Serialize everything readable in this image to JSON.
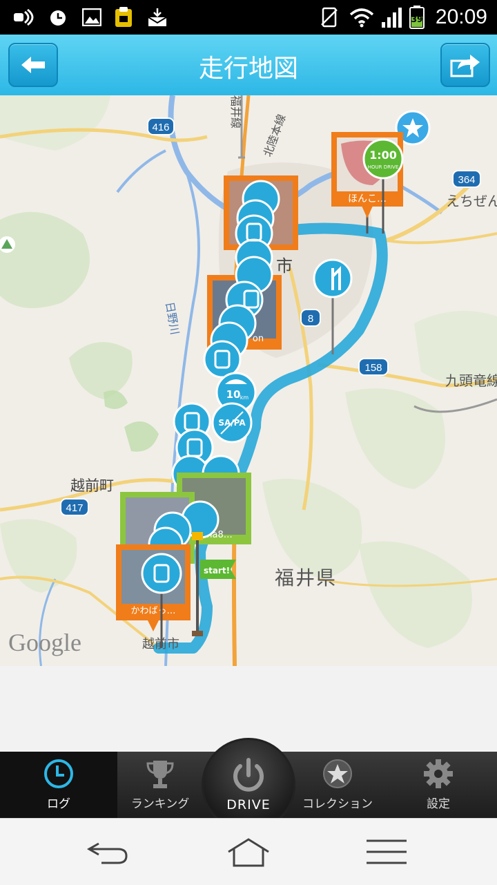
{
  "status_bar": {
    "time": "20:09",
    "battery": "39",
    "icons": [
      "cast-icon",
      "alarm-icon",
      "image-icon",
      "clipboard-icon",
      "mail-icon",
      "vibrate-icon",
      "wifi-icon",
      "signal-icon",
      "battery-icon"
    ]
  },
  "header": {
    "title": "走行地図",
    "back_icon": "back-arrow-icon",
    "share_icon": "share-icon"
  },
  "map": {
    "provider_logo": "Google",
    "labels": {
      "route_416": "416",
      "route_364": "364",
      "route_8": "8",
      "route_158": "158",
      "route_417": "417",
      "city_shi": "市",
      "echizen_cho": "越前町",
      "fukui_pref": "福井県",
      "kuzuryu": "九頭竜線",
      "echizen_right": "えちぜん",
      "hino_river": "日野川",
      "hokuriku": "北陸本線",
      "fukui_line": "福井線",
      "echizen_bottom": "越前市"
    },
    "pins": [
      {
        "caption": "ほんこ…",
        "frame": "orange"
      },
      {
        "caption": "",
        "frame": "orange"
      },
      {
        "caption": "on",
        "frame": "orange"
      },
      {
        "caption": "na8…",
        "frame": "green"
      },
      {
        "caption": "",
        "frame": "green"
      },
      {
        "caption": "かわばっ…",
        "frame": "orange"
      }
    ],
    "badges": {
      "hour_drive_top": "1:00",
      "hour_drive_bottom": "HOUR DRIVE",
      "km": "10",
      "km_unit": "km",
      "sapa": "SA/PA",
      "start": "start!"
    }
  },
  "tab_bar": {
    "tabs": [
      {
        "label": "ログ",
        "icon": "clock-icon",
        "active": true
      },
      {
        "label": "ランキング",
        "icon": "trophy-icon",
        "active": false
      },
      {
        "label": "DRIVE",
        "icon": "power-icon",
        "active": false
      },
      {
        "label": "コレクション",
        "icon": "star-circle-icon",
        "active": false
      },
      {
        "label": "設定",
        "icon": "gear-icon",
        "active": false
      }
    ]
  },
  "nav_bar": {
    "buttons": [
      "back-icon",
      "home-icon",
      "menu-icon"
    ]
  },
  "colors": {
    "accent": "#2db7e6",
    "route": "#29a9d9",
    "pin_orange": "#f07d1a",
    "pin_green": "#8cc63f"
  }
}
